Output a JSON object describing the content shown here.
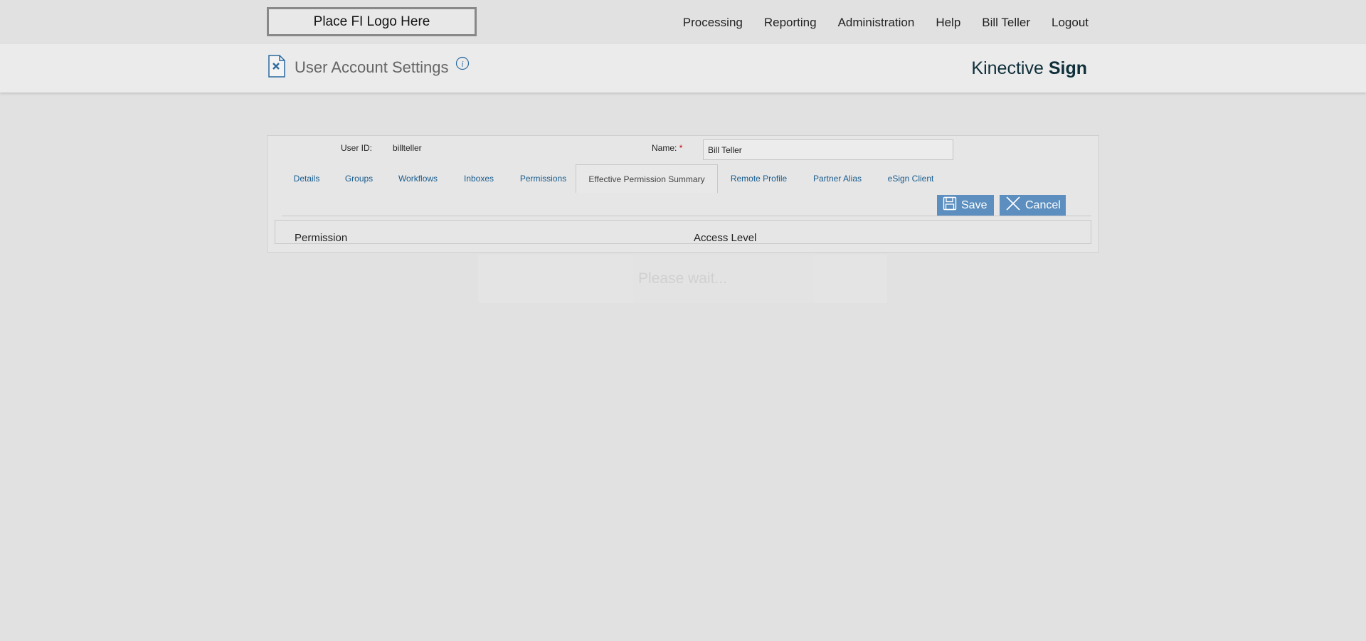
{
  "header": {
    "logo_text": "Place FI Logo Here",
    "nav": [
      "Processing",
      "Reporting",
      "Administration",
      "Help",
      "Bill Teller",
      "Logout"
    ]
  },
  "subheader": {
    "title": "User Account Settings",
    "brand_light": "Kinective",
    "brand_bold": "Sign"
  },
  "form": {
    "user_id_label": "User ID:",
    "user_id_value": "billteller",
    "name_label": "Name:",
    "required_mark": "*",
    "name_value": "Bill Teller"
  },
  "tabs": [
    {
      "label": "Details"
    },
    {
      "label": "Groups"
    },
    {
      "label": "Workflows"
    },
    {
      "label": "Inboxes"
    },
    {
      "label": "Permissions"
    },
    {
      "label": "Effective Permission Summary",
      "active": true
    },
    {
      "label": "Remote Profile"
    },
    {
      "label": "Partner Alias"
    },
    {
      "label": "eSign Client"
    }
  ],
  "buttons": {
    "save": "Save",
    "cancel": "Cancel"
  },
  "table": {
    "columns": [
      "Permission",
      "Access Level"
    ]
  },
  "overlay": {
    "text": "Please wait..."
  },
  "icons": {
    "doc": "settings-document-icon",
    "info": "info-icon",
    "save": "floppy-disk-icon",
    "cancel": "close-icon"
  },
  "colors": {
    "accent": "#5c8fbf",
    "link": "#1a5d8e",
    "brand": "#0f2f3a"
  }
}
